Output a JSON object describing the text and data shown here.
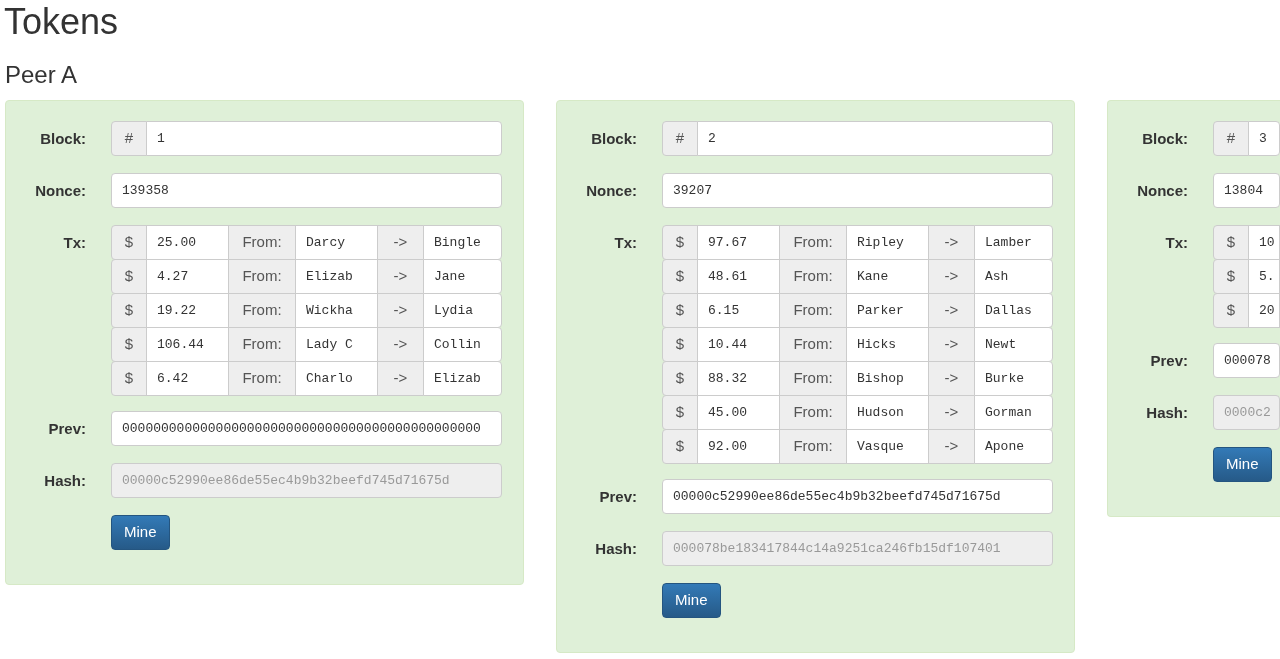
{
  "title": "Tokens",
  "peer": "Peer A",
  "blocks": [
    {
      "block_label": "Block:",
      "block_prefix": "#",
      "number": "1",
      "nonce_label": "Nonce:",
      "nonce": "139358",
      "tx_label": "Tx:",
      "transactions": [
        {
          "currency": "$",
          "amount": "25.00",
          "from_label": "From:",
          "from": "Darcy",
          "arrow": "->",
          "to": "Bingle"
        },
        {
          "currency": "$",
          "amount": "4.27",
          "from_label": "From:",
          "from": "Elizab",
          "arrow": "->",
          "to": "Jane"
        },
        {
          "currency": "$",
          "amount": "19.22",
          "from_label": "From:",
          "from": "Wickha",
          "arrow": "->",
          "to": "Lydia"
        },
        {
          "currency": "$",
          "amount": "106.44",
          "from_label": "From:",
          "from": "Lady C",
          "arrow": "->",
          "to": "Collin"
        },
        {
          "currency": "$",
          "amount": "6.42",
          "from_label": "From:",
          "from": "Charlo",
          "arrow": "->",
          "to": "Elizab"
        }
      ],
      "prev_label": "Prev:",
      "prev": "0000000000000000000000000000000000000000000000",
      "hash_label": "Hash:",
      "hash": {
        "value": "00000c52990ee86de55ec4b9b32beefd745d71675d",
        "disabled": true
      },
      "button": "Mine"
    },
    {
      "block_label": "Block:",
      "block_prefix": "#",
      "number": "2",
      "nonce_label": "Nonce:",
      "nonce": "39207",
      "tx_label": "Tx:",
      "transactions": [
        {
          "currency": "$",
          "amount": "97.67",
          "from_label": "From:",
          "from": "Ripley",
          "arrow": "->",
          "to": "Lamber"
        },
        {
          "currency": "$",
          "amount": "48.61",
          "from_label": "From:",
          "from": "Kane",
          "arrow": "->",
          "to": "Ash"
        },
        {
          "currency": "$",
          "amount": "6.15",
          "from_label": "From:",
          "from": "Parker",
          "arrow": "->",
          "to": "Dallas"
        },
        {
          "currency": "$",
          "amount": "10.44",
          "from_label": "From:",
          "from": "Hicks",
          "arrow": "->",
          "to": "Newt"
        },
        {
          "currency": "$",
          "amount": "88.32",
          "from_label": "From:",
          "from": "Bishop",
          "arrow": "->",
          "to": "Burke"
        },
        {
          "currency": "$",
          "amount": "45.00",
          "from_label": "From:",
          "from": "Hudson",
          "arrow": "->",
          "to": "Gorman"
        },
        {
          "currency": "$",
          "amount": "92.00",
          "from_label": "From:",
          "from": "Vasque",
          "arrow": "->",
          "to": "Apone"
        }
      ],
      "prev_label": "Prev:",
      "prev": "00000c52990ee86de55ec4b9b32beefd745d71675d",
      "hash_label": "Hash:",
      "hash": {
        "value": "000078be183417844c14a9251ca246fb15df107401",
        "disabled": true
      },
      "button": "Mine"
    },
    {
      "block_label": "Block:",
      "block_prefix": "#",
      "number": "3",
      "nonce_label": "Nonce:",
      "nonce": "13804",
      "tx_label": "Tx:",
      "transactions": [
        {
          "currency": "$",
          "amount": "10"
        },
        {
          "currency": "$",
          "amount": "5."
        },
        {
          "currency": "$",
          "amount": "20"
        }
      ],
      "prev_label": "Prev:",
      "prev": "000078",
      "hash_label": "Hash:",
      "hash": {
        "value": "0000c2",
        "disabled": true
      },
      "button": "Mine"
    }
  ]
}
